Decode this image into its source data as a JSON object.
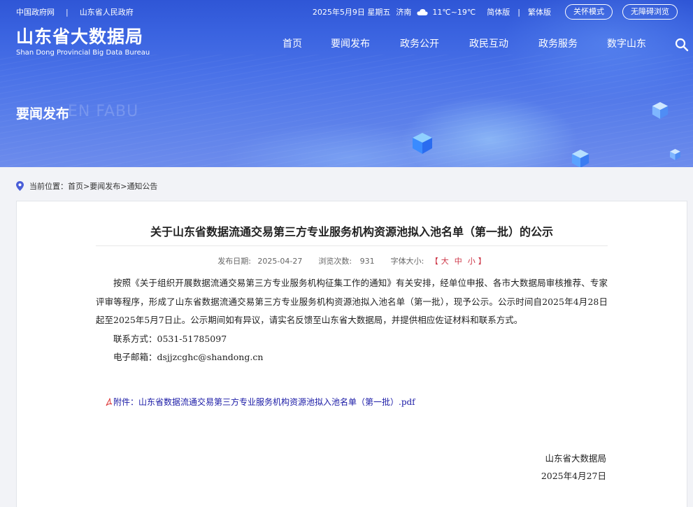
{
  "topbar": {
    "gov_link": "中国政府网",
    "sep": "|",
    "province_link": "山东省人民政府",
    "date": "2025年5月9日 星期五",
    "city": "济南",
    "temp": "11℃~19℃",
    "simplified": "简体版",
    "traditional": "繁体版",
    "care_mode": "关怀模式",
    "accessibility": "无障碍浏览"
  },
  "logo": {
    "cn": "山东省大数据局",
    "en": "Shan Dong Provincial Big Data Bureau"
  },
  "nav": {
    "items": [
      "首页",
      "要闻发布",
      "政务公开",
      "政民互动",
      "政务服务",
      "数字山东"
    ]
  },
  "section": {
    "title": "要闻发布",
    "ghost": "EN FABU"
  },
  "breadcrumb": {
    "label": "当前位置：",
    "home": "首页",
    "sep1": "> ",
    "news": "要闻发布",
    "sep2": "> ",
    "current": "通知公告"
  },
  "article": {
    "title": "关于山东省数据流通交易第三方专业服务机构资源池拟入池名单（第一批）的公示",
    "meta": {
      "date_label": "发布日期:",
      "date": "2025-04-27",
      "views_label": "浏览次数:",
      "views": "931",
      "font_label": "字体大小:",
      "font_open": "【",
      "font_large": "大",
      "font_mid": "中",
      "font_small": "小",
      "font_close": "】"
    },
    "paragraph": "按照《关于组织开展数据流通交易第三方专业服务机构征集工作的通知》有关安排，经单位申报、各市大数据局审核推荐、专家评审等程序，形成了山东省数据流通交易第三方专业服务机构资源池拟入池名单（第一批），现予公示。公示时间自2025年4月28日起至2025年5月7日止。公示期间如有异议，请实名反馈至山东省大数据局，并提供相应佐证材料和联系方式。",
    "contact": "联系方式：0531-51785097",
    "email": "电子邮箱：dsjjzcghc@shandong.cn",
    "attachment": "附件：山东省数据流通交易第三方专业服务机构资源池拟入池名单（第一批）.pdf",
    "signer": "山东省大数据局",
    "sign_date": "2025年4月27日"
  },
  "colors": {
    "banner": "#3a63e0",
    "attachment_link": "#1a1aa6",
    "font_size_control": "#cc3344"
  }
}
